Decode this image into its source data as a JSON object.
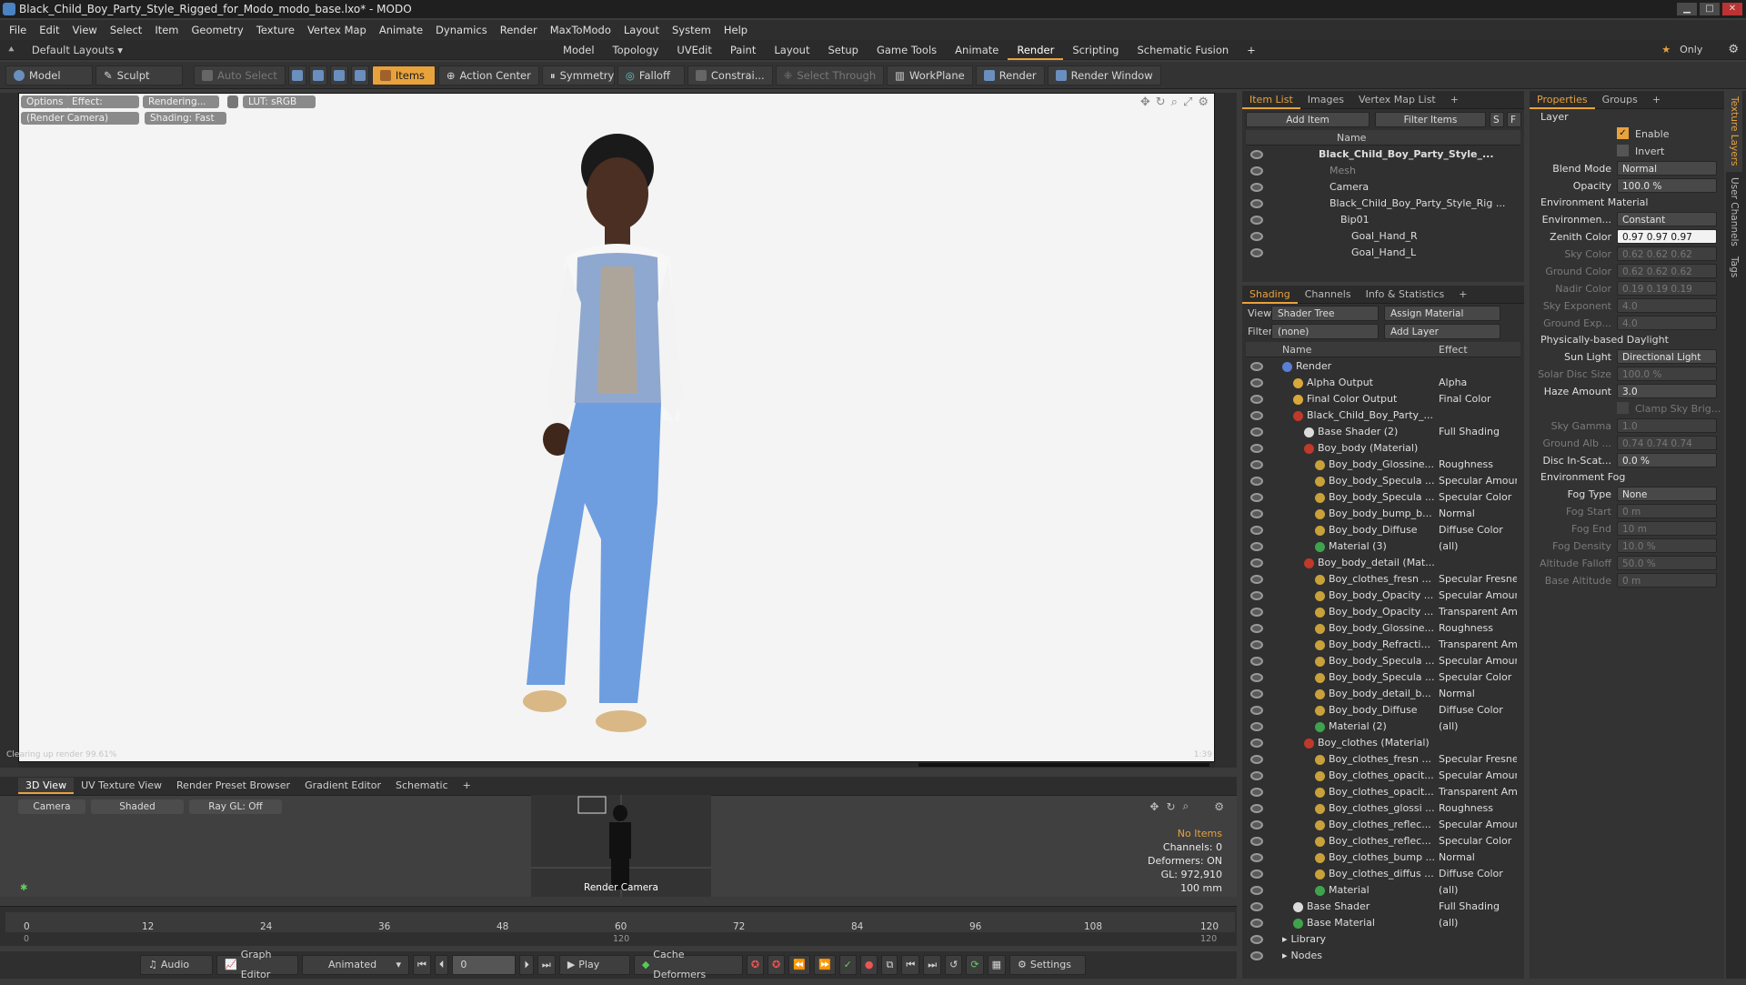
{
  "window": {
    "title": "Black_Child_Boy_Party_Style_Rigged_for_Modo_modo_base.lxo* - MODO"
  },
  "menu": [
    "File",
    "Edit",
    "View",
    "Select",
    "Item",
    "Geometry",
    "Texture",
    "Vertex Map",
    "Animate",
    "Dynamics",
    "Render",
    "MaxToModo",
    "Layout",
    "System",
    "Help"
  ],
  "layout_bar": {
    "preset": "Default Layouts",
    "tabs": [
      "Model",
      "Topology",
      "UVEdit",
      "Paint",
      "Layout",
      "Setup",
      "Game Tools",
      "Animate",
      "Render",
      "Scripting",
      "Schematic Fusion"
    ],
    "active_tab": "Render",
    "only_label": "Only"
  },
  "toolbar": {
    "model": "Model",
    "sculpt": "Sculpt",
    "auto_select": "Auto Select",
    "items": "Items",
    "action_center": "Action Center",
    "symmetry": "Symmetry",
    "falloff": "Falloff",
    "constraints": "Constrai...",
    "select_through": "Select Through",
    "workplane": "WorkPlane",
    "render": "Render",
    "render_window": "Render Window"
  },
  "viewport": {
    "options": "Options",
    "effect": "Effect: (Shadi...",
    "rendering": "Rendering...",
    "lut": "LUT: sRGB",
    "camera": "(Render Camera)",
    "shading": "Shading: Fast",
    "bottom_left": "Clearing up render 99.61%",
    "bottom_right": "1:39"
  },
  "lower_tabs": [
    "3D View",
    "UV Texture View",
    "Render Preset Browser",
    "Gradient Editor",
    "Schematic"
  ],
  "lower_view": {
    "camera": "Camera",
    "shaded": "Shaded",
    "raygl": "Ray GL: Off",
    "minimap_label": "Render Camera",
    "stats": {
      "no_items": "No Items",
      "channels": "Channels: 0",
      "deformers": "Deformers: ON",
      "gl": "GL: 972,910",
      "focal": "100 mm"
    }
  },
  "timeline": {
    "ticks": [
      "0",
      "12",
      "24",
      "36",
      "48",
      "60",
      "72",
      "84",
      "96",
      "108",
      "120"
    ],
    "bottom_ticks": [
      "0",
      "120",
      "120"
    ]
  },
  "transport": {
    "audio": "Audio",
    "graph_editor": "Graph Editor",
    "animated": "Animated",
    "frame": "0",
    "play": "Play",
    "cache_deformers": "Cache Deformers",
    "settings": "Settings"
  },
  "item_list": {
    "tabs": [
      "Item List",
      "Images",
      "Vertex Map List"
    ],
    "add_item": "Add Item",
    "filter_items": "Filter Items",
    "name_header": "Name",
    "items": [
      {
        "label": "Black_Child_Boy_Party_Style_...",
        "indent": 0
      },
      {
        "label": "Mesh",
        "indent": 1
      },
      {
        "label": "Camera",
        "indent": 1
      },
      {
        "label": "Black_Child_Boy_Party_Style_Rig ...",
        "indent": 1
      },
      {
        "label": "Bip01",
        "indent": 2
      },
      {
        "label": "Goal_Hand_R",
        "indent": 3
      },
      {
        "label": "Goal_Hand_L",
        "indent": 3
      }
    ]
  },
  "shading": {
    "tabs": [
      "Shading",
      "Channels",
      "Info & Statistics"
    ],
    "view_label": "View",
    "view_value": "Shader Tree",
    "assign_material": "Assign Material",
    "filter_label": "Filter",
    "filter_value": "(none)",
    "add_layer": "Add Layer",
    "name_header": "Name",
    "effect_header": "Effect",
    "rows": [
      {
        "name": "Render",
        "effect": "",
        "indent": 0,
        "color": "#5b7fd6"
      },
      {
        "name": "Alpha Output",
        "effect": "Alpha",
        "indent": 1,
        "color": "#d9a83a"
      },
      {
        "name": "Final Color Output",
        "effect": "Final Color",
        "indent": 1,
        "color": "#d9a83a"
      },
      {
        "name": "Black_Child_Boy_Party_...",
        "effect": "",
        "indent": 1,
        "color": "#c0392b"
      },
      {
        "name": "Base Shader (2)",
        "effect": "Full Shading",
        "indent": 2,
        "color": "#dcdcdc"
      },
      {
        "name": "Boy_body (Material)",
        "effect": "",
        "indent": 2,
        "color": "#c0392b"
      },
      {
        "name": "Boy_body_Glossine...",
        "effect": "Roughness",
        "indent": 3,
        "color": "#c9a13a"
      },
      {
        "name": "Boy_body_Specula ...",
        "effect": "Specular Amount",
        "indent": 3,
        "color": "#c9a13a"
      },
      {
        "name": "Boy_body_Specula ...",
        "effect": "Specular Color",
        "indent": 3,
        "color": "#c9a13a"
      },
      {
        "name": "Boy_body_bump_b...",
        "effect": "Normal",
        "indent": 3,
        "color": "#c9a13a"
      },
      {
        "name": "Boy_body_Diffuse",
        "effect": "Diffuse Color",
        "indent": 3,
        "color": "#c9a13a"
      },
      {
        "name": "Material (3)",
        "effect": "(all)",
        "indent": 3,
        "color": "#3fa34d"
      },
      {
        "name": "Boy_body_detail (Mat...",
        "effect": "",
        "indent": 2,
        "color": "#c0392b"
      },
      {
        "name": "Boy_clothes_fresn ...",
        "effect": "Specular Fresnel",
        "indent": 3,
        "color": "#c9a13a"
      },
      {
        "name": "Boy_body_Opacity ...",
        "effect": "Specular Amount",
        "indent": 3,
        "color": "#c9a13a"
      },
      {
        "name": "Boy_body_Opacity ...",
        "effect": "Transparent Am...",
        "indent": 3,
        "color": "#c9a13a"
      },
      {
        "name": "Boy_body_Glossine...",
        "effect": "Roughness",
        "indent": 3,
        "color": "#c9a13a"
      },
      {
        "name": "Boy_body_Refracti...",
        "effect": "Transparent Am...",
        "indent": 3,
        "color": "#c9a13a"
      },
      {
        "name": "Boy_body_Specula ...",
        "effect": "Specular Amount",
        "indent": 3,
        "color": "#c9a13a"
      },
      {
        "name": "Boy_body_Specula ...",
        "effect": "Specular Color",
        "indent": 3,
        "color": "#c9a13a"
      },
      {
        "name": "Boy_body_detail_b...",
        "effect": "Normal",
        "indent": 3,
        "color": "#c9a13a"
      },
      {
        "name": "Boy_body_Diffuse",
        "effect": "Diffuse Color",
        "indent": 3,
        "color": "#c9a13a"
      },
      {
        "name": "Material (2)",
        "effect": "(all)",
        "indent": 3,
        "color": "#3fa34d"
      },
      {
        "name": "Boy_clothes (Material)",
        "effect": "",
        "indent": 2,
        "color": "#c0392b"
      },
      {
        "name": "Boy_clothes_fresn ...",
        "effect": "Specular Fresnel",
        "indent": 3,
        "color": "#c9a13a"
      },
      {
        "name": "Boy_clothes_opacit...",
        "effect": "Specular Amount",
        "indent": 3,
        "color": "#c9a13a"
      },
      {
        "name": "Boy_clothes_opacit...",
        "effect": "Transparent Am...",
        "indent": 3,
        "color": "#c9a13a"
      },
      {
        "name": "Boy_clothes_glossi ...",
        "effect": "Roughness",
        "indent": 3,
        "color": "#c9a13a"
      },
      {
        "name": "Boy_clothes_reflec...",
        "effect": "Specular Amount",
        "indent": 3,
        "color": "#c9a13a"
      },
      {
        "name": "Boy_clothes_reflec...",
        "effect": "Specular Color",
        "indent": 3,
        "color": "#c9a13a"
      },
      {
        "name": "Boy_clothes_bump ...",
        "effect": "Normal",
        "indent": 3,
        "color": "#c9a13a"
      },
      {
        "name": "Boy_clothes_diffus ...",
        "effect": "Diffuse Color",
        "indent": 3,
        "color": "#c9a13a"
      },
      {
        "name": "Material",
        "effect": "(all)",
        "indent": 3,
        "color": "#3fa34d"
      },
      {
        "name": "Base Shader",
        "effect": "Full Shading",
        "indent": 1,
        "color": "#dcdcdc"
      },
      {
        "name": "Base Material",
        "effect": "(all)",
        "indent": 1,
        "color": "#3fa34d"
      },
      {
        "name": "Library",
        "effect": "",
        "indent": 0,
        "color": ""
      },
      {
        "name": "Nodes",
        "effect": "",
        "indent": 0,
        "color": ""
      }
    ]
  },
  "properties": {
    "tabs": [
      "Properties",
      "Groups"
    ],
    "layer": "Layer",
    "enable": "Enable",
    "invert": "Invert",
    "blend_mode_label": "Blend Mode",
    "blend_mode": "Normal",
    "opacity_label": "Opacity",
    "opacity": "100.0 %",
    "env_material": "Environment Material",
    "environment_label": "Environmen...",
    "environment": "Constant",
    "zenith_label": "Zenith Color",
    "zenith": "0.97 0.97 0.97",
    "sky_label": "Sky Color",
    "sky": "0.62 0.62 0.62",
    "ground_label": "Ground Color",
    "ground": "0.62 0.62 0.62",
    "nadir_label": "Nadir Color",
    "nadir": "0.19 0.19 0.19",
    "sky_exp_label": "Sky Exponent",
    "sky_exp": "4.0",
    "ground_exp_label": "Ground Exp...",
    "ground_exp": "4.0",
    "daylight": "Physically-based Daylight",
    "sun_light_label": "Sun Light",
    "sun_light": "Directional Light",
    "solar_label": "Solar Disc Size",
    "solar": "100.0 %",
    "haze_label": "Haze Amount",
    "haze": "3.0",
    "clamp": "Clamp Sky Brig...",
    "sky_gamma_label": "Sky Gamma",
    "sky_gamma": "1.0",
    "ground_alb_label": "Ground Alb ...",
    "ground_alb": "0.74 0.74 0.74",
    "disc_label": "Disc In-Scat...",
    "disc": "0.0 %",
    "env_fog": "Environment Fog",
    "fog_type_label": "Fog Type",
    "fog_type": "None",
    "fog_start_label": "Fog Start",
    "fog_start": "0 m",
    "fog_end_label": "Fog End",
    "fog_end": "10 m",
    "fog_density_label": "Fog Density",
    "fog_density": "10.0 %",
    "alt_falloff_label": "Altitude Falloff",
    "alt_falloff": "50.0 %",
    "base_alt_label": "Base Altitude",
    "base_alt": "0 m"
  },
  "vertical_tabs": [
    "Texture Layers",
    "User Channels",
    "Tags"
  ],
  "colors": {
    "accent": "#e8a23c",
    "viewport_bg": "#f4f4f4",
    "panel_bg": "#303030"
  }
}
